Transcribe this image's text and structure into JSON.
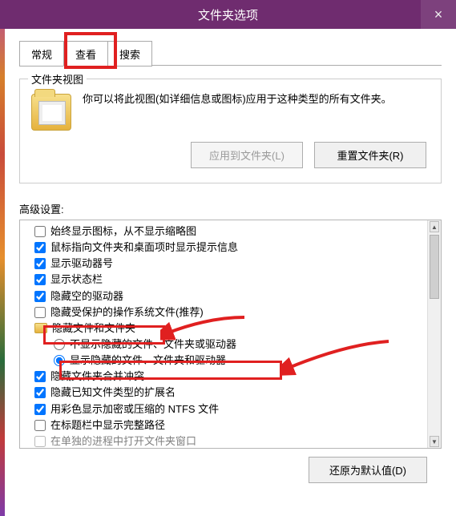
{
  "titlebar": {
    "title": "文件夹选项",
    "close": "×"
  },
  "tabs": {
    "t0": "常规",
    "t1": "查看",
    "t2": "搜索"
  },
  "folderview": {
    "label": "文件夹视图",
    "desc": "你可以将此视图(如详细信息或图标)应用于这种类型的所有文件夹。",
    "apply": "应用到文件夹(L)",
    "reset": "重置文件夹(R)"
  },
  "advanced": {
    "label": "高级设置:",
    "items": {
      "i0": "始终显示图标，从不显示缩略图",
      "i1": "鼠标指向文件夹和桌面项时显示提示信息",
      "i2": "显示驱动器号",
      "i3": "显示状态栏",
      "i4": "隐藏空的驱动器",
      "i5": "隐藏受保护的操作系统文件(推荐)",
      "g0": "隐藏文件和文件夹",
      "r0": "不显示隐藏的文件、文件夹或驱动器",
      "r1": "显示隐藏的文件、文件夹和驱动器",
      "i6": "隐藏文件夹合并冲突",
      "i7": "隐藏已知文件类型的扩展名",
      "i8": "用彩色显示加密或压缩的 NTFS 文件",
      "i9": "在标题栏中显示完整路径",
      "i10": "在单独的进程中打开文件夹窗口"
    }
  },
  "footer": {
    "restore": "还原为默认值(D)"
  }
}
